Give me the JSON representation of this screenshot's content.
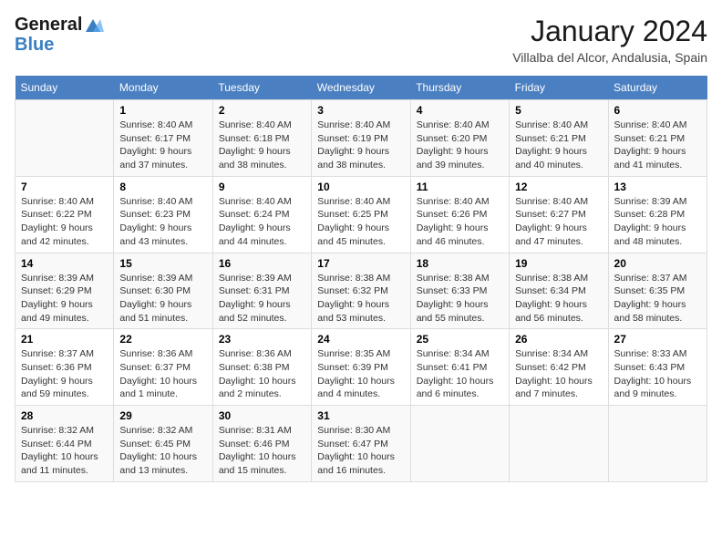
{
  "header": {
    "logo_line1": "General",
    "logo_line2": "Blue",
    "month_title": "January 2024",
    "location": "Villalba del Alcor, Andalusia, Spain"
  },
  "days_of_week": [
    "Sunday",
    "Monday",
    "Tuesday",
    "Wednesday",
    "Thursday",
    "Friday",
    "Saturday"
  ],
  "weeks": [
    [
      {
        "day": "",
        "sunrise": "",
        "sunset": "",
        "daylight": ""
      },
      {
        "day": "1",
        "sunrise": "Sunrise: 8:40 AM",
        "sunset": "Sunset: 6:17 PM",
        "daylight": "Daylight: 9 hours and 37 minutes."
      },
      {
        "day": "2",
        "sunrise": "Sunrise: 8:40 AM",
        "sunset": "Sunset: 6:18 PM",
        "daylight": "Daylight: 9 hours and 38 minutes."
      },
      {
        "day": "3",
        "sunrise": "Sunrise: 8:40 AM",
        "sunset": "Sunset: 6:19 PM",
        "daylight": "Daylight: 9 hours and 38 minutes."
      },
      {
        "day": "4",
        "sunrise": "Sunrise: 8:40 AM",
        "sunset": "Sunset: 6:20 PM",
        "daylight": "Daylight: 9 hours and 39 minutes."
      },
      {
        "day": "5",
        "sunrise": "Sunrise: 8:40 AM",
        "sunset": "Sunset: 6:21 PM",
        "daylight": "Daylight: 9 hours and 40 minutes."
      },
      {
        "day": "6",
        "sunrise": "Sunrise: 8:40 AM",
        "sunset": "Sunset: 6:21 PM",
        "daylight": "Daylight: 9 hours and 41 minutes."
      }
    ],
    [
      {
        "day": "7",
        "sunrise": "Sunrise: 8:40 AM",
        "sunset": "Sunset: 6:22 PM",
        "daylight": "Daylight: 9 hours and 42 minutes."
      },
      {
        "day": "8",
        "sunrise": "Sunrise: 8:40 AM",
        "sunset": "Sunset: 6:23 PM",
        "daylight": "Daylight: 9 hours and 43 minutes."
      },
      {
        "day": "9",
        "sunrise": "Sunrise: 8:40 AM",
        "sunset": "Sunset: 6:24 PM",
        "daylight": "Daylight: 9 hours and 44 minutes."
      },
      {
        "day": "10",
        "sunrise": "Sunrise: 8:40 AM",
        "sunset": "Sunset: 6:25 PM",
        "daylight": "Daylight: 9 hours and 45 minutes."
      },
      {
        "day": "11",
        "sunrise": "Sunrise: 8:40 AM",
        "sunset": "Sunset: 6:26 PM",
        "daylight": "Daylight: 9 hours and 46 minutes."
      },
      {
        "day": "12",
        "sunrise": "Sunrise: 8:40 AM",
        "sunset": "Sunset: 6:27 PM",
        "daylight": "Daylight: 9 hours and 47 minutes."
      },
      {
        "day": "13",
        "sunrise": "Sunrise: 8:39 AM",
        "sunset": "Sunset: 6:28 PM",
        "daylight": "Daylight: 9 hours and 48 minutes."
      }
    ],
    [
      {
        "day": "14",
        "sunrise": "Sunrise: 8:39 AM",
        "sunset": "Sunset: 6:29 PM",
        "daylight": "Daylight: 9 hours and 49 minutes."
      },
      {
        "day": "15",
        "sunrise": "Sunrise: 8:39 AM",
        "sunset": "Sunset: 6:30 PM",
        "daylight": "Daylight: 9 hours and 51 minutes."
      },
      {
        "day": "16",
        "sunrise": "Sunrise: 8:39 AM",
        "sunset": "Sunset: 6:31 PM",
        "daylight": "Daylight: 9 hours and 52 minutes."
      },
      {
        "day": "17",
        "sunrise": "Sunrise: 8:38 AM",
        "sunset": "Sunset: 6:32 PM",
        "daylight": "Daylight: 9 hours and 53 minutes."
      },
      {
        "day": "18",
        "sunrise": "Sunrise: 8:38 AM",
        "sunset": "Sunset: 6:33 PM",
        "daylight": "Daylight: 9 hours and 55 minutes."
      },
      {
        "day": "19",
        "sunrise": "Sunrise: 8:38 AM",
        "sunset": "Sunset: 6:34 PM",
        "daylight": "Daylight: 9 hours and 56 minutes."
      },
      {
        "day": "20",
        "sunrise": "Sunrise: 8:37 AM",
        "sunset": "Sunset: 6:35 PM",
        "daylight": "Daylight: 9 hours and 58 minutes."
      }
    ],
    [
      {
        "day": "21",
        "sunrise": "Sunrise: 8:37 AM",
        "sunset": "Sunset: 6:36 PM",
        "daylight": "Daylight: 9 hours and 59 minutes."
      },
      {
        "day": "22",
        "sunrise": "Sunrise: 8:36 AM",
        "sunset": "Sunset: 6:37 PM",
        "daylight": "Daylight: 10 hours and 1 minute."
      },
      {
        "day": "23",
        "sunrise": "Sunrise: 8:36 AM",
        "sunset": "Sunset: 6:38 PM",
        "daylight": "Daylight: 10 hours and 2 minutes."
      },
      {
        "day": "24",
        "sunrise": "Sunrise: 8:35 AM",
        "sunset": "Sunset: 6:39 PM",
        "daylight": "Daylight: 10 hours and 4 minutes."
      },
      {
        "day": "25",
        "sunrise": "Sunrise: 8:34 AM",
        "sunset": "Sunset: 6:41 PM",
        "daylight": "Daylight: 10 hours and 6 minutes."
      },
      {
        "day": "26",
        "sunrise": "Sunrise: 8:34 AM",
        "sunset": "Sunset: 6:42 PM",
        "daylight": "Daylight: 10 hours and 7 minutes."
      },
      {
        "day": "27",
        "sunrise": "Sunrise: 8:33 AM",
        "sunset": "Sunset: 6:43 PM",
        "daylight": "Daylight: 10 hours and 9 minutes."
      }
    ],
    [
      {
        "day": "28",
        "sunrise": "Sunrise: 8:32 AM",
        "sunset": "Sunset: 6:44 PM",
        "daylight": "Daylight: 10 hours and 11 minutes."
      },
      {
        "day": "29",
        "sunrise": "Sunrise: 8:32 AM",
        "sunset": "Sunset: 6:45 PM",
        "daylight": "Daylight: 10 hours and 13 minutes."
      },
      {
        "day": "30",
        "sunrise": "Sunrise: 8:31 AM",
        "sunset": "Sunset: 6:46 PM",
        "daylight": "Daylight: 10 hours and 15 minutes."
      },
      {
        "day": "31",
        "sunrise": "Sunrise: 8:30 AM",
        "sunset": "Sunset: 6:47 PM",
        "daylight": "Daylight: 10 hours and 16 minutes."
      },
      {
        "day": "",
        "sunrise": "",
        "sunset": "",
        "daylight": ""
      },
      {
        "day": "",
        "sunrise": "",
        "sunset": "",
        "daylight": ""
      },
      {
        "day": "",
        "sunrise": "",
        "sunset": "",
        "daylight": ""
      }
    ]
  ]
}
